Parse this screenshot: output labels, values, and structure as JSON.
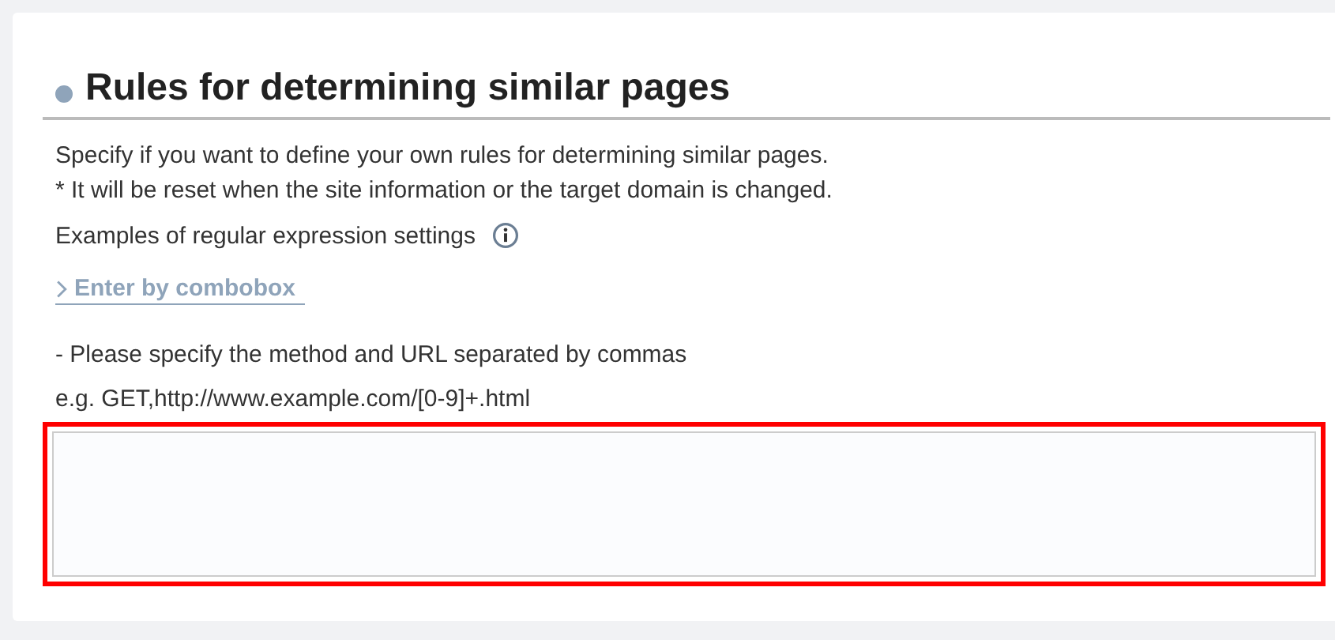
{
  "section": {
    "title": "Rules for determining similar pages",
    "description": [
      "Specify if you want to define your own rules for determining similar pages.",
      "* It will be reset when the site information or the target domain is changed."
    ],
    "examples_label": "Examples of regular expression settings",
    "combobox_link": "Enter by combobox",
    "hints": [
      "- Please specify the method and URL separated by commas",
      "e.g. GET,http://www.example.com/[0-9]+.html"
    ],
    "rules_field": {
      "highlighted": true
    }
  }
}
